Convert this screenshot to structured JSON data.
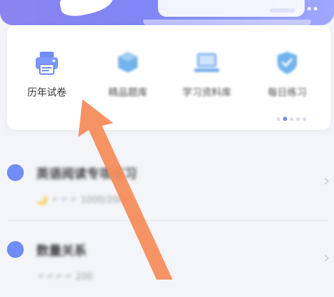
{
  "quick_actions": [
    {
      "label": "历年试卷",
      "icon": "printer-icon"
    },
    {
      "label": "精品题库",
      "icon": "box-icon"
    },
    {
      "label": "学习资料库",
      "icon": "laptop-icon"
    },
    {
      "label": "每日练习",
      "icon": "shield-icon"
    }
  ],
  "list": [
    {
      "title": "英语阅读专项练习",
      "meta_first": "🌙",
      "meta_rest": "〃〃〃 1000/2000"
    },
    {
      "title": "数量关系",
      "meta_first": "",
      "meta_rest": "〃〃〃〃 200"
    }
  ],
  "colors": {
    "accent": "#6f8cf7",
    "banner": "#8a83f0",
    "overlay_arrow": "#f58d5c"
  }
}
